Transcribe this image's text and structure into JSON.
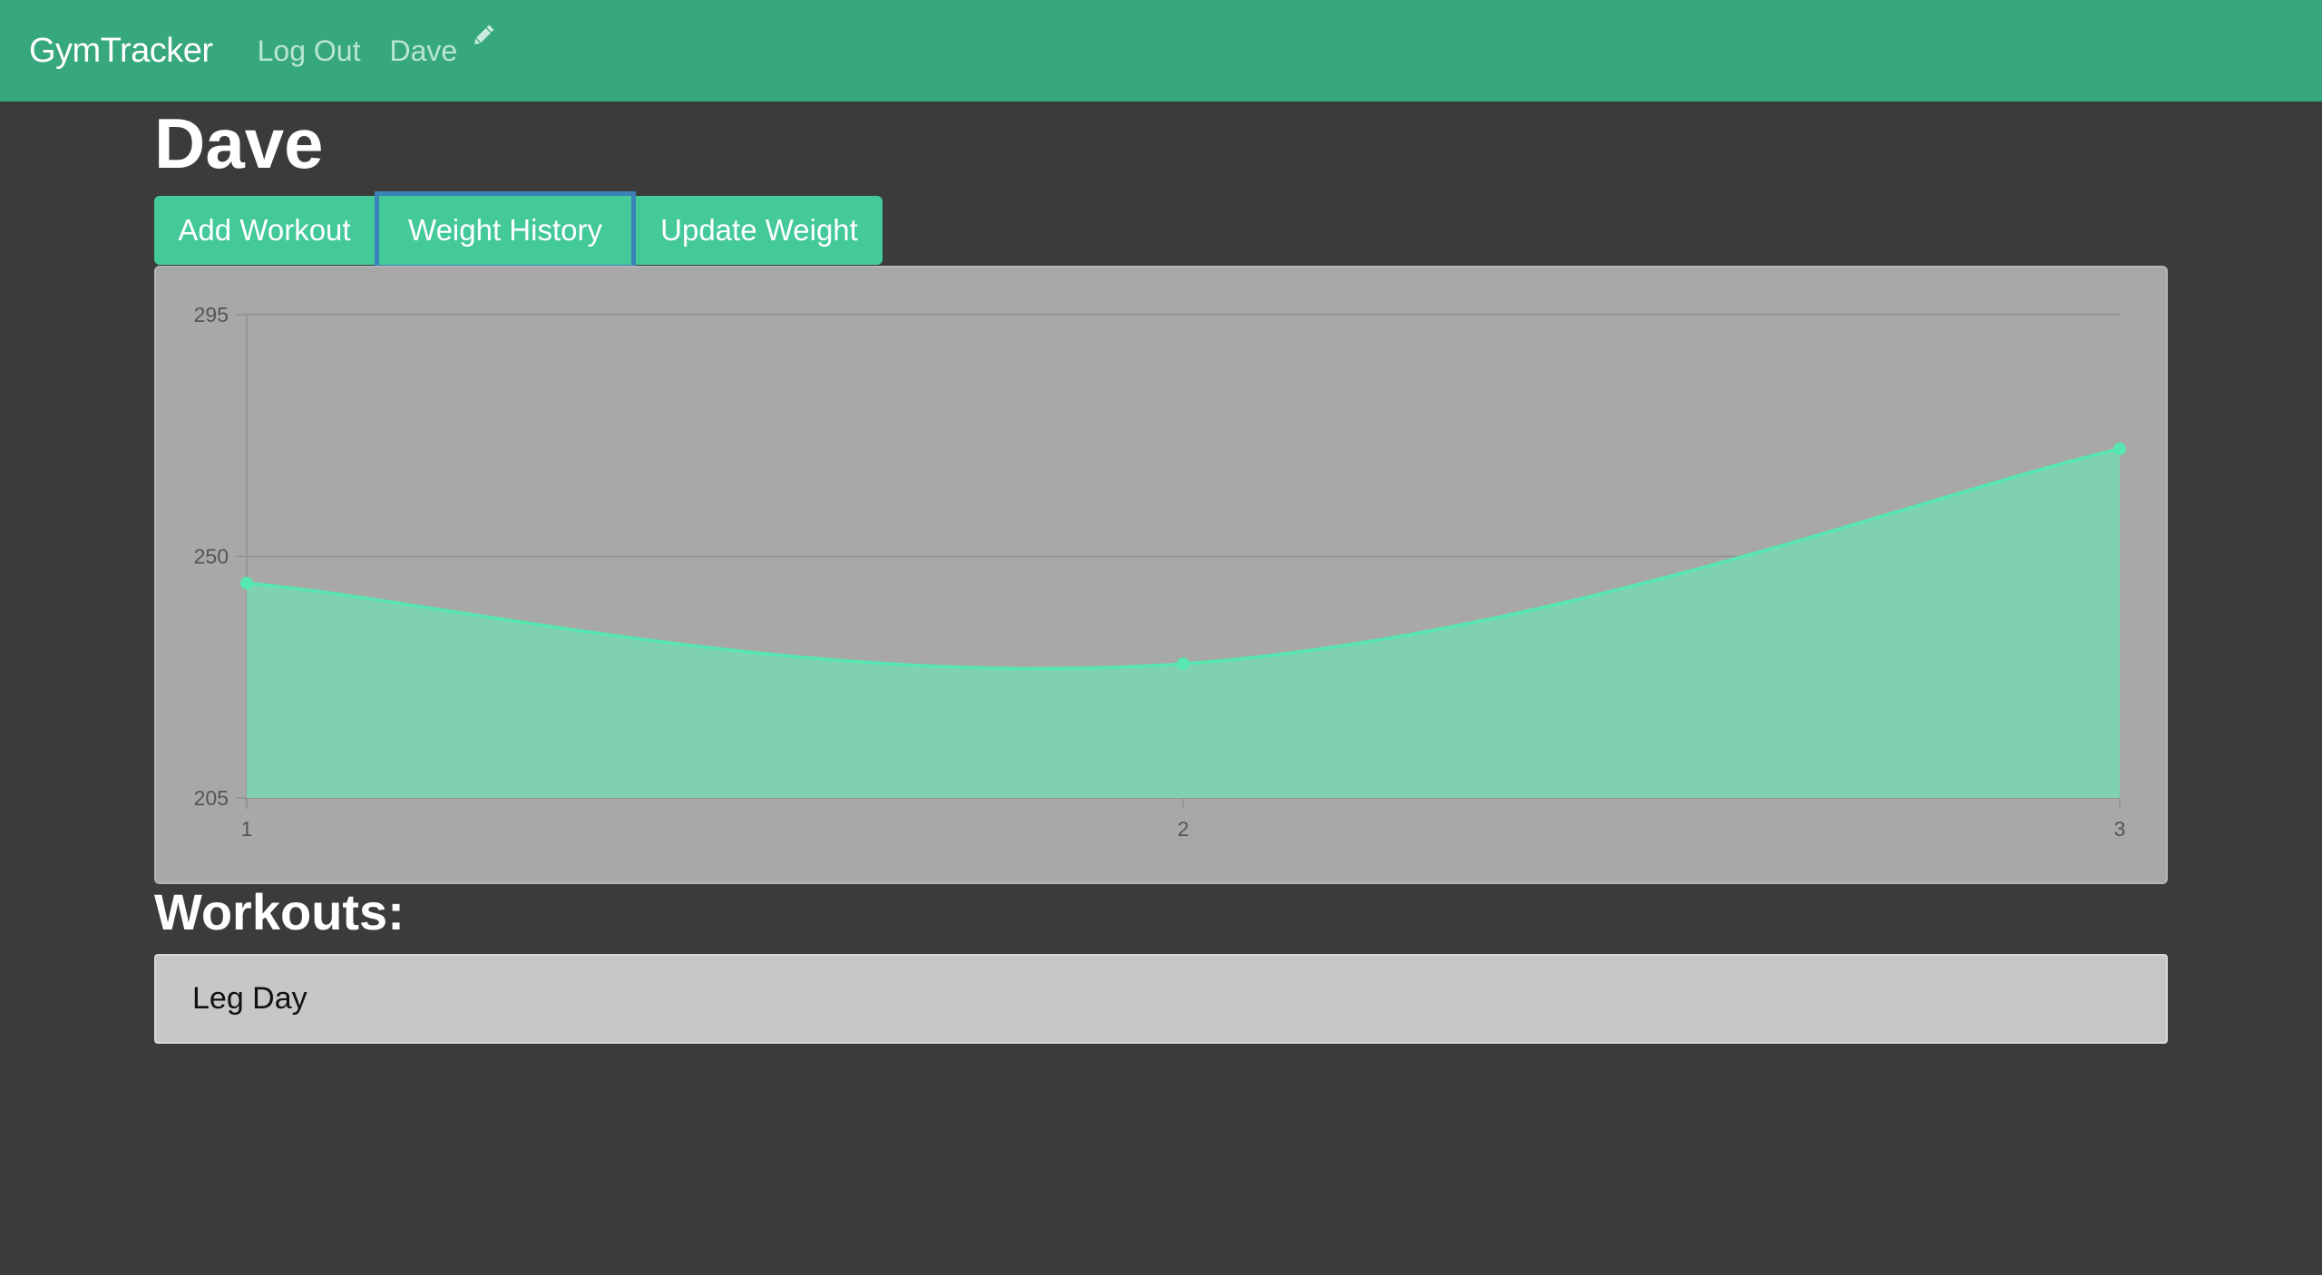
{
  "app": {
    "brand": "GymTracker"
  },
  "nav": {
    "logout_label": "Log Out",
    "user_label": "Dave",
    "edit_icon": "pencil-icon"
  },
  "page": {
    "title": "Dave"
  },
  "actions": {
    "add_workout_label": "Add Workout",
    "weight_history_label": "Weight History",
    "update_weight_label": "Update Weight"
  },
  "workouts": {
    "heading": "Workouts:",
    "items": [
      "Leg Day"
    ]
  },
  "colors": {
    "navbar": "#37a77d",
    "accent": "#44c999",
    "line": "#56e8b0",
    "fill": "#7dd3b2",
    "selected_outline": "#3a82b8"
  },
  "chart_data": {
    "type": "area",
    "x": [
      1,
      2,
      3
    ],
    "values": [
      245,
      230,
      270
    ],
    "ylim": [
      205,
      295
    ],
    "yticks": [
      205,
      250,
      295
    ],
    "xticks": [
      1,
      2,
      3
    ],
    "grid": true,
    "smooth": true
  }
}
